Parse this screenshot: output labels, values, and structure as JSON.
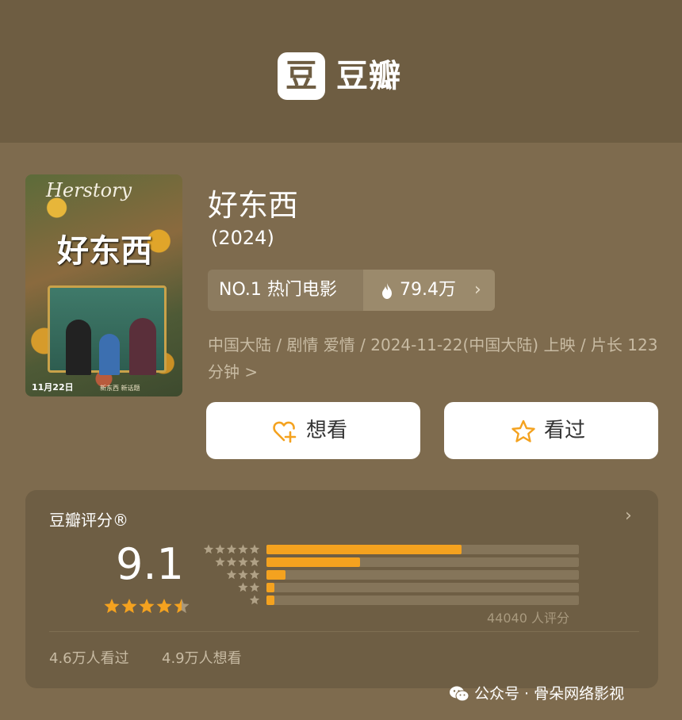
{
  "header": {
    "logo_glyph": "豆",
    "logo_text": "豆瓣"
  },
  "poster": {
    "script_title": "Herstory",
    "title": "好东西",
    "date": "11月22日",
    "tagline": "新东西 新话题"
  },
  "movie": {
    "title": "好东西",
    "year": "(2024)",
    "rank_label": "NO.1 热门电影",
    "heat": "79.4万",
    "meta": "中国大陆 / 剧情 爱情 / 2024-11-22(中国大陆) 上映 / 片长 123分钟",
    "meta_chevron": ">"
  },
  "actions": {
    "want": "想看",
    "seen": "看过"
  },
  "rating": {
    "title": "豆瓣评分®",
    "score": "9.1",
    "star_rating": 4.5,
    "distribution": [
      {
        "stars": 5,
        "fraction": 0.625
      },
      {
        "stars": 4,
        "fraction": 0.3
      },
      {
        "stars": 3,
        "fraction": 0.06
      },
      {
        "stars": 2,
        "fraction": 0.025
      },
      {
        "stars": 1,
        "fraction": 0.025
      }
    ],
    "votes": "44040 人评分",
    "watched": "4.6万人看过",
    "wish": "4.9万人想看"
  },
  "watermark": {
    "text": "公众号 · 骨朵网络影视"
  },
  "colors": {
    "accent": "#f4a21f",
    "background": "#7e6b4e",
    "header": "#6e5d42"
  }
}
